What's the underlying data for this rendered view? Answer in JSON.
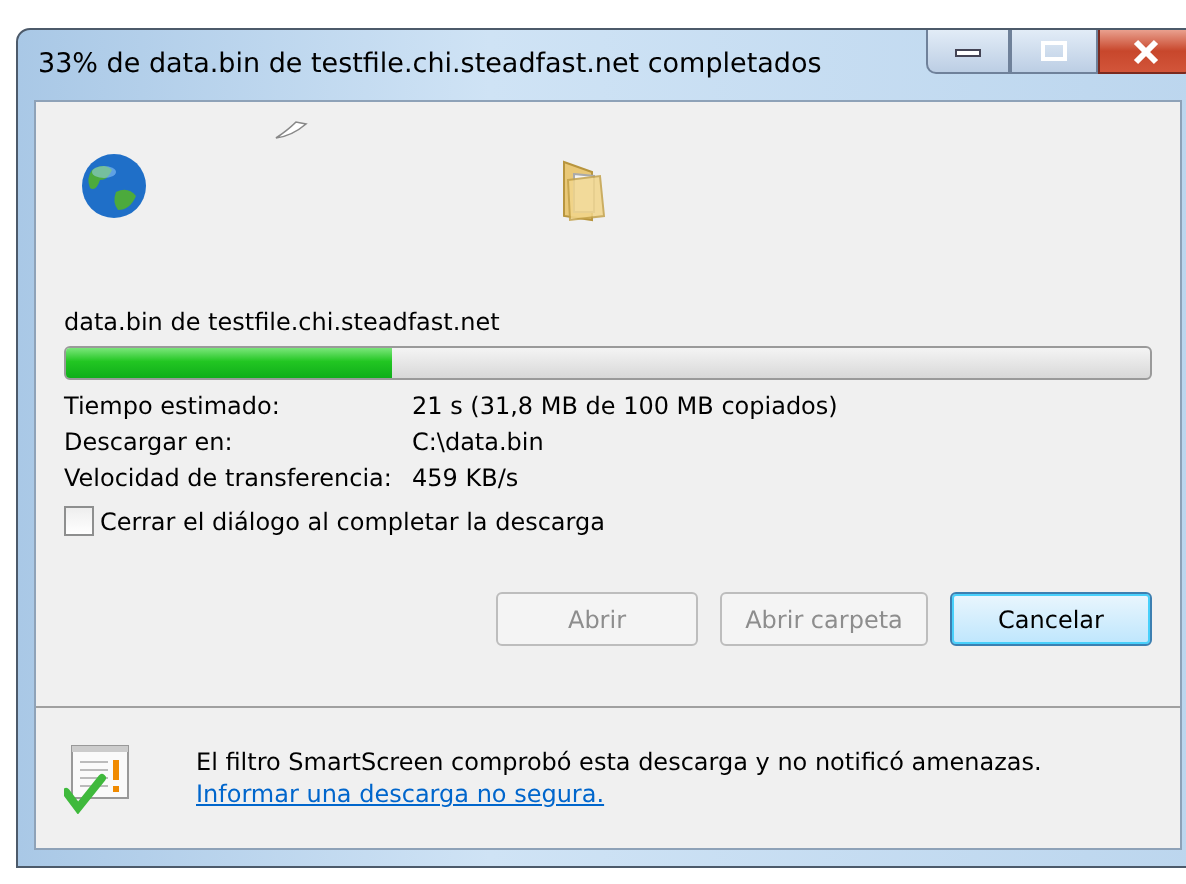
{
  "window": {
    "title": "33% de data.bin de testfile.chi.steadfast.net completados"
  },
  "source": "data.bin de testfile.chi.steadfast.net",
  "progress": {
    "level": 0.3
  },
  "details": [
    {
      "label": "Tiempo estimado:",
      "value": "21 s (31,8 MB de 100 MB copiados)"
    },
    {
      "label": "Descargar en:",
      "value": "C:\\data.bin"
    },
    {
      "label": "Velocidad de transferencia:",
      "value": "459 KB/s"
    }
  ],
  "close_when_done": {
    "label": "Cerrar el diálogo al completar la descarga",
    "checked": false
  },
  "buttons": [
    {
      "label": "Abrir",
      "disabled": true,
      "selected": false
    },
    {
      "label": "Abrir carpeta",
      "disabled": true,
      "selected": false
    },
    {
      "label": "Cancelar",
      "disabled": false,
      "selected": true
    }
  ],
  "footer": {
    "message": "El filtro SmartScreen comprobó esta descarga y no notificó amenazas.",
    "link": "Informar una descarga no segura."
  }
}
